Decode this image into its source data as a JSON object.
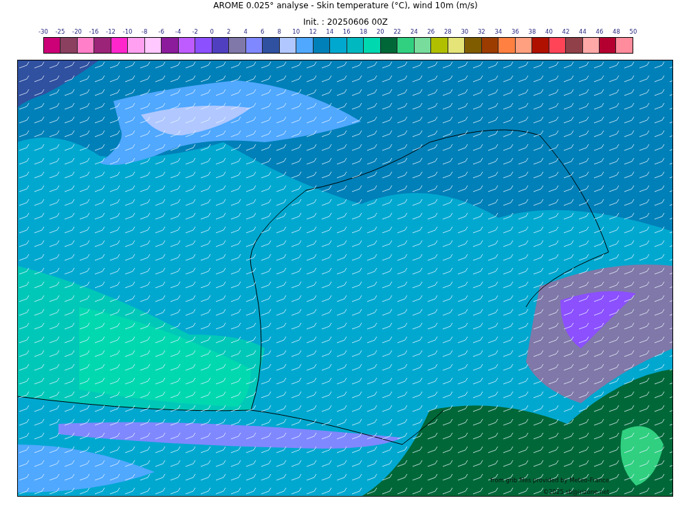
{
  "title": "AROME 0.025° analyse - Skin temperature (°C), wind 10m (m/s)",
  "subtitle": "Init. : 20250606 00Z",
  "colorbar": {
    "ticks": [
      "-30",
      "-25",
      "-20",
      "-16",
      "-12",
      "-10",
      "-8",
      "-6",
      "-4",
      "-2",
      "0",
      "2",
      "4",
      "6",
      "8",
      "10",
      "12",
      "14",
      "16",
      "18",
      "20",
      "22",
      "24",
      "26",
      "28",
      "30",
      "32",
      "34",
      "36",
      "38",
      "40",
      "42",
      "44",
      "46",
      "48",
      "50"
    ],
    "bins": [
      {
        "color": "#cc0077"
      },
      {
        "color": "#8b4060"
      },
      {
        "color": "#ff80c8"
      },
      {
        "color": "#9b2478"
      },
      {
        "color": "#ff26cc"
      },
      {
        "color": "#ffa0f0"
      },
      {
        "color": "#ffc8ff"
      },
      {
        "color": "#8c1c9c"
      },
      {
        "color": "#bf5cff"
      },
      {
        "color": "#8c50ff"
      },
      {
        "color": "#5040c0"
      },
      {
        "color": "#8078a8"
      },
      {
        "color": "#8088ff"
      },
      {
        "color": "#3050a0"
      },
      {
        "color": "#b0c8ff"
      },
      {
        "color": "#50a8ff"
      },
      {
        "color": "#0080b8"
      },
      {
        "color": "#00a8d0"
      },
      {
        "color": "#00b8c0"
      },
      {
        "color": "#00d8b0"
      },
      {
        "color": "#006838"
      },
      {
        "color": "#30d080"
      },
      {
        "color": "#78dc9c"
      },
      {
        "color": "#b0c000"
      },
      {
        "color": "#e4e478"
      },
      {
        "color": "#805c00"
      },
      {
        "color": "#9c3c00"
      },
      {
        "color": "#ff8040"
      },
      {
        "color": "#ffa080"
      },
      {
        "color": "#b01000"
      },
      {
        "color": "#ff4458"
      },
      {
        "color": "#904048"
      },
      {
        "color": "#ffa8a8"
      },
      {
        "color": "#b40030"
      },
      {
        "color": "#ff8c9c"
      }
    ]
  },
  "map": {
    "credits": [
      "from grib files provided by Meteo-France",
      "©2025 sb@irizone.net"
    ]
  }
}
